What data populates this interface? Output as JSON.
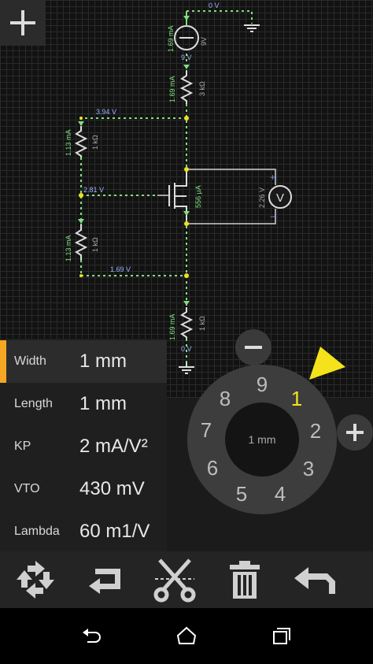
{
  "circuit": {
    "v_top_ground": "0 V",
    "source_voltage": "9V",
    "source_current": "1.69 mA",
    "source_node": "9 V",
    "r_top_current": "1.69 mA",
    "r_top_value": "3 kΩ",
    "node_gate_top": "3.94 V",
    "r1_current": "1.13 mA",
    "r1_value": "1 kΩ",
    "node_gate": "2.81 V",
    "r2_current": "1.13 mA",
    "r2_value": "1 kΩ",
    "node_source": "1.69 V",
    "drain_current": "556 µA",
    "meter_voltage": "2.26 V",
    "meter_symbol": "V",
    "meter_plus": "+",
    "meter_minus": "−",
    "r_bottom_current": "1.69 mA",
    "r_bottom_value": "1 kΩ",
    "node_bottom": "0 V",
    "wire_color": "#7fe07f",
    "dot_color": "#f0e020"
  },
  "properties": [
    {
      "name": "Width",
      "value": "1 mm",
      "selected": true
    },
    {
      "name": "Length",
      "value": "1 mm"
    },
    {
      "name": "KP",
      "value": "2 mA/V²"
    },
    {
      "name": "VTO",
      "value": "430 mV"
    },
    {
      "name": "Lambda",
      "value": "60 m1/V"
    }
  ],
  "dial": {
    "center_value": "1 mm",
    "digits": [
      "9",
      "1",
      "2",
      "3",
      "4",
      "5",
      "6",
      "7",
      "8"
    ],
    "active_digit": "1",
    "accent": "#f4e21b"
  },
  "toolbar": {
    "icons": [
      "rotate-icon",
      "flip-icon",
      "cut-icon",
      "delete-icon",
      "undo-icon"
    ]
  },
  "nav": {
    "icons": [
      "back-icon",
      "home-icon",
      "recents-icon"
    ]
  }
}
